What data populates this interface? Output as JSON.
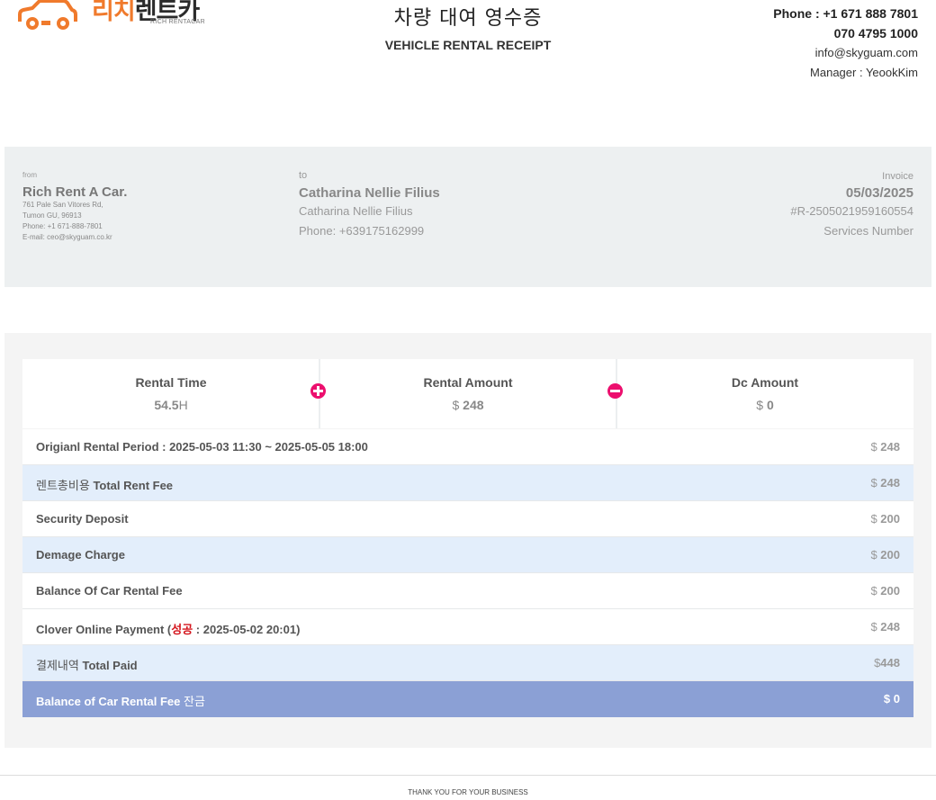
{
  "header": {
    "logo_ko": "리치렌트카",
    "logo_ko_part1": "리치",
    "logo_ko_part2": "렌트카",
    "logo_sub": "RICH RENTACAR",
    "title_ko": "차량 대여 영수증",
    "title_en": "VEHICLE RENTAL RECEIPT",
    "phone": "Phone : +1 671 888 7801",
    "phone2": "070 4795 1000",
    "email": "info@skyguam.com",
    "manager": "Manager : YeookKim"
  },
  "from": {
    "label": "from",
    "name": "Rich Rent A Car.",
    "address1": "761 Pale San Vitores Rd,",
    "address2": "Tumon GU, 96913",
    "phone": "Phone: +1 671-888-7801",
    "email": "E-mail: ceo@skyguam.co.kr"
  },
  "to": {
    "label": "to",
    "name": "Catharina Nellie Filius",
    "name2": "Catharina Nellie Filius",
    "phone": "Phone: +639175162999"
  },
  "invoice": {
    "label": "Invoice",
    "date": "05/03/2025",
    "number": "#R-2505021959160554",
    "services": "Services Number"
  },
  "stats": [
    {
      "label": "Rental Time",
      "value": "54.5",
      "unit": "H"
    },
    {
      "label": "Rental Amount",
      "currency": "$",
      "value": "248"
    },
    {
      "label": "Dc Amount",
      "currency": "$",
      "value": "0"
    }
  ],
  "rows": [
    {
      "label": "Origianl Rental Period : 2025-05-03 11:30 ~ 2025-05-05 18:00",
      "currency": "$",
      "amount": "248",
      "style": "white"
    },
    {
      "label_ko": "렌트총비용",
      "label": "Total Rent Fee",
      "currency": "$",
      "amount": "248",
      "style": "blue"
    },
    {
      "label": "Security Deposit",
      "currency": "$",
      "amount": "200",
      "style": "white"
    },
    {
      "label": "Demage Charge",
      "currency": "$",
      "amount": "200",
      "style": "blue"
    },
    {
      "label": "Balance Of Car Rental Fee",
      "currency": "$",
      "amount": "200",
      "style": "white"
    },
    {
      "label_pre": "Clover Online Payment (",
      "label_status": "성공",
      "label_post": " : 2025-05-02 20:01)",
      "currency": "$",
      "amount": "248",
      "style": "white"
    },
    {
      "label_ko": "결제내역",
      "label": "Total Paid",
      "currency": "$",
      "amount": "448",
      "style": "blue"
    },
    {
      "label": "Balance of Car Rental Fee",
      "label_ko": "잔금",
      "currency": "$",
      "amount": "0",
      "style": "dark"
    }
  ],
  "footer": "THANK YOU FOR YOUR BUSINESS",
  "colors": {
    "brand_orange": "#f07a2c",
    "accent_pink": "#ec0f6e",
    "row_blue": "#e3eefb",
    "row_dark": "#8ba0d5",
    "status_red": "#d4141c"
  }
}
